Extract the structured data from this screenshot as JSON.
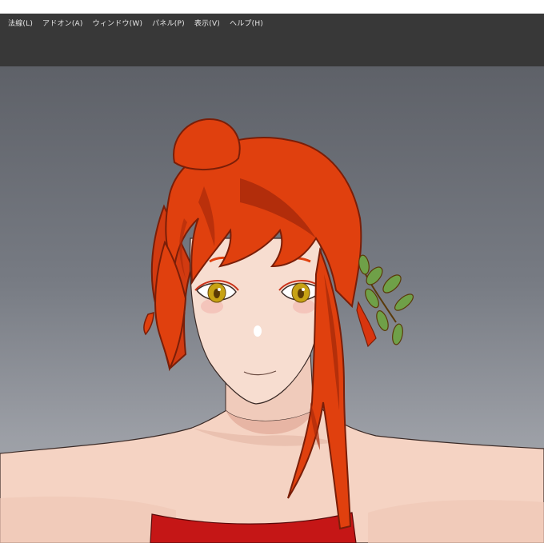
{
  "menubar": {
    "items": [
      {
        "label": "法線(L)"
      },
      {
        "label": "アドオン(A)"
      },
      {
        "label": "ウィンドウ(W)"
      },
      {
        "label": "パネル(P)"
      },
      {
        "label": "表示(V)"
      },
      {
        "label": "ヘルプ(H)"
      }
    ]
  },
  "colors": {
    "menubar_bg": "#383838",
    "viewport_top": "#5e6168",
    "viewport_bottom": "#a7a9ae",
    "hair": "#e0400e",
    "hair_shadow": "#a92a0a",
    "skin": "#f6d8c8",
    "eye": "#c7a214",
    "leaf": "#6fa048",
    "dress": "#c51616"
  }
}
